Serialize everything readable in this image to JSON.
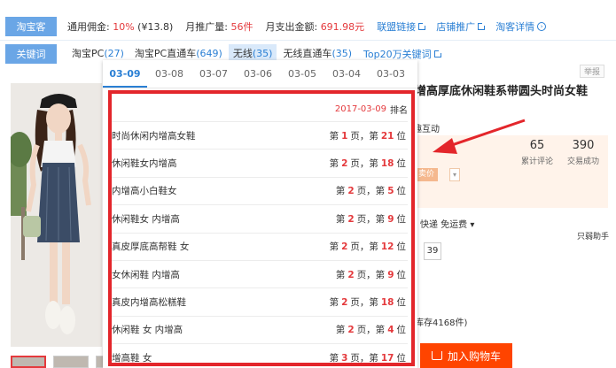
{
  "bar1": {
    "tag": "淘宝客",
    "commission_label": "通用佣金:",
    "commission_value": "10%",
    "commission_amount": "(¥13.8)",
    "monthly_promo_label": "月推广量:",
    "monthly_promo_value": "56件",
    "monthly_pay_label": "月支出金额:",
    "monthly_pay_value": "691.98元",
    "links": [
      "联盟链接",
      "店铺推广",
      "淘客详情"
    ]
  },
  "bar2": {
    "tag": "关键词",
    "keywords": [
      {
        "label": "淘宝PC",
        "count": "(27)"
      },
      {
        "label": "淘宝PC直通车",
        "count": "(649)"
      },
      {
        "label": "无线",
        "count": "(35)"
      },
      {
        "label": "无线直通车",
        "count": "(35)"
      }
    ],
    "top_link": "Top20万关键词"
  },
  "popup": {
    "dates": [
      "03-09",
      "03-08",
      "03-07",
      "03-06",
      "03-05",
      "03-04",
      "03-03"
    ],
    "header_date": "2017-03-09",
    "header_label": "排名",
    "rows": [
      {
        "keyword": "时尚休闲内增高女鞋",
        "page": "1",
        "pos": "21"
      },
      {
        "keyword": "休闲鞋女内增高",
        "page": "2",
        "pos": "18"
      },
      {
        "keyword": "内增高小白鞋女",
        "page": "2",
        "pos": "5"
      },
      {
        "keyword": "休闲鞋女 内增高",
        "page": "2",
        "pos": "9"
      },
      {
        "keyword": "真皮厚底高帮鞋 女",
        "page": "2",
        "pos": "12"
      },
      {
        "keyword": "女休闲鞋 内增高",
        "page": "2",
        "pos": "9"
      },
      {
        "keyword": "真皮内增高松糕鞋",
        "page": "2",
        "pos": "18"
      },
      {
        "keyword": "休闲鞋 女 内增高",
        "page": "2",
        "pos": "4"
      },
      {
        "keyword": "增高鞋 女",
        "page": "3",
        "pos": "17"
      }
    ],
    "rank_prefix": "第",
    "page_unit": "页，第",
    "pos_unit": "位"
  },
  "product": {
    "title": "增高厚底休闲鞋系带圆头时尚女鞋",
    "report": "举报",
    "interact": "趣互动",
    "reviews_value": "65",
    "reviews_label": "累计评论",
    "deals_value": "390",
    "deals_label": "交易成功",
    "price_btn": "卖价",
    "delivery": "快递 免运费",
    "weak": "只弱助手",
    "qty": "39",
    "stock": "库存4168件)",
    "cart": "加入购物车"
  }
}
